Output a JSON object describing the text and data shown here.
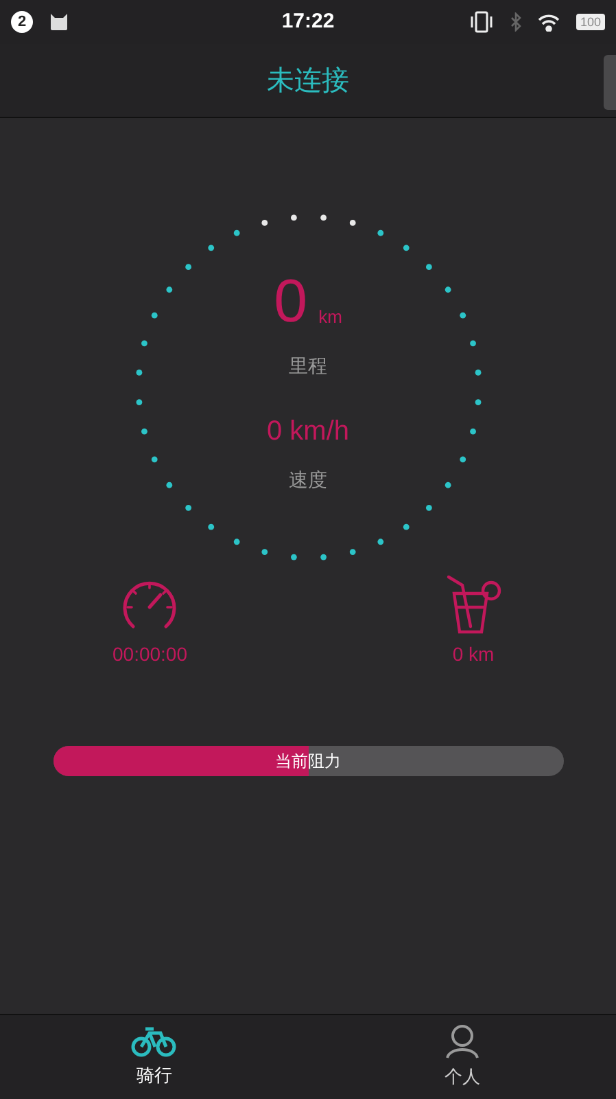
{
  "status_bar": {
    "notification_count": "2",
    "time": "17:22",
    "battery": "100"
  },
  "header": {
    "title": "未连接"
  },
  "dial": {
    "distance_value": "0",
    "distance_unit": "km",
    "distance_label": "里程",
    "speed": "0 km/h",
    "speed_label": "速度"
  },
  "stats": [
    {
      "kind": "timer",
      "value": "00:00:00"
    },
    {
      "kind": "drink",
      "value": "0 km"
    }
  ],
  "resistance": {
    "label": "当前阻力",
    "level": 0.5
  },
  "tabs": [
    {
      "kind": "ride",
      "label": "骑行",
      "selected": true
    },
    {
      "kind": "profile",
      "label": "个人",
      "selected": false
    }
  ]
}
